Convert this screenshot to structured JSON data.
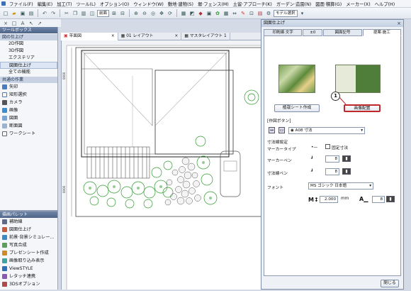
{
  "menu": [
    "ファイル(F)",
    "編集(E)",
    "加工(T)",
    "ツール(L)",
    "オプション(O)",
    "ウィンドウ(W)",
    "敷地·建物(S)",
    "塀·フェンス(M)",
    "土留·アプローチ(K)",
    "ガーデン·造園(N)",
    "図面·積算(G)",
    "メーカー(X)",
    "ヘルプ(H)"
  ],
  "toolbar": {
    "layer_select": "前面",
    "model_select": "モデル選択"
  },
  "toolbox": {
    "title": "ツールボックス",
    "category_active": "図の仕上げ",
    "items": [
      "2D作図",
      "3D作図",
      "エクステリア",
      "図面仕上げ",
      "全ての機能"
    ],
    "group2": "共通の作業",
    "tools": [
      "矢印",
      "矩形選択",
      "カメラ",
      "画像",
      "図面",
      "断面図",
      "ワークシート"
    ]
  },
  "palette": {
    "title": "描画パレット",
    "items": [
      "補助線",
      "図面仕上げ",
      "前景·背景シミュレー...",
      "写真合成",
      "プレゼンシート作成",
      "画像取り込み表示",
      "ViewSTYLE",
      "レタッチ連携",
      "3DSオプション"
    ]
  },
  "tabs": [
    "平面図",
    "01 レイアウト",
    "マスタレイアウト 1"
  ],
  "ruler": {
    "left_mark": "0000",
    "top_mark": "0000",
    "bottom_mark": "0000"
  },
  "dialog": {
    "title": "図面仕上げ",
    "tabs": [
      "印刷線·文字",
      "±0",
      "図面記号",
      "提案·施工"
    ],
    "btn_sheet": "植栽シート作成",
    "btn_place": "画像配置",
    "callout": "1",
    "section": "[作図ボタン]",
    "dim_select": "A08 寸法",
    "dim_settings": "寸法線設定",
    "marker_type": "マーカータイプ",
    "fixed_dim": "固定寸法",
    "marker_pen": "マーカーペン",
    "dim_pen": "寸法線ペン",
    "pen_value": "8",
    "font_label": "フォント",
    "font_value": "MS ゴシック 日本語",
    "size_value": "2.000",
    "size_unit": "mm",
    "pen2_value": "8",
    "close": "閉じる"
  },
  "colors": {
    "accent": "#3b6fb6",
    "callout": "#c0282c",
    "plant": "#2f9a2f"
  }
}
